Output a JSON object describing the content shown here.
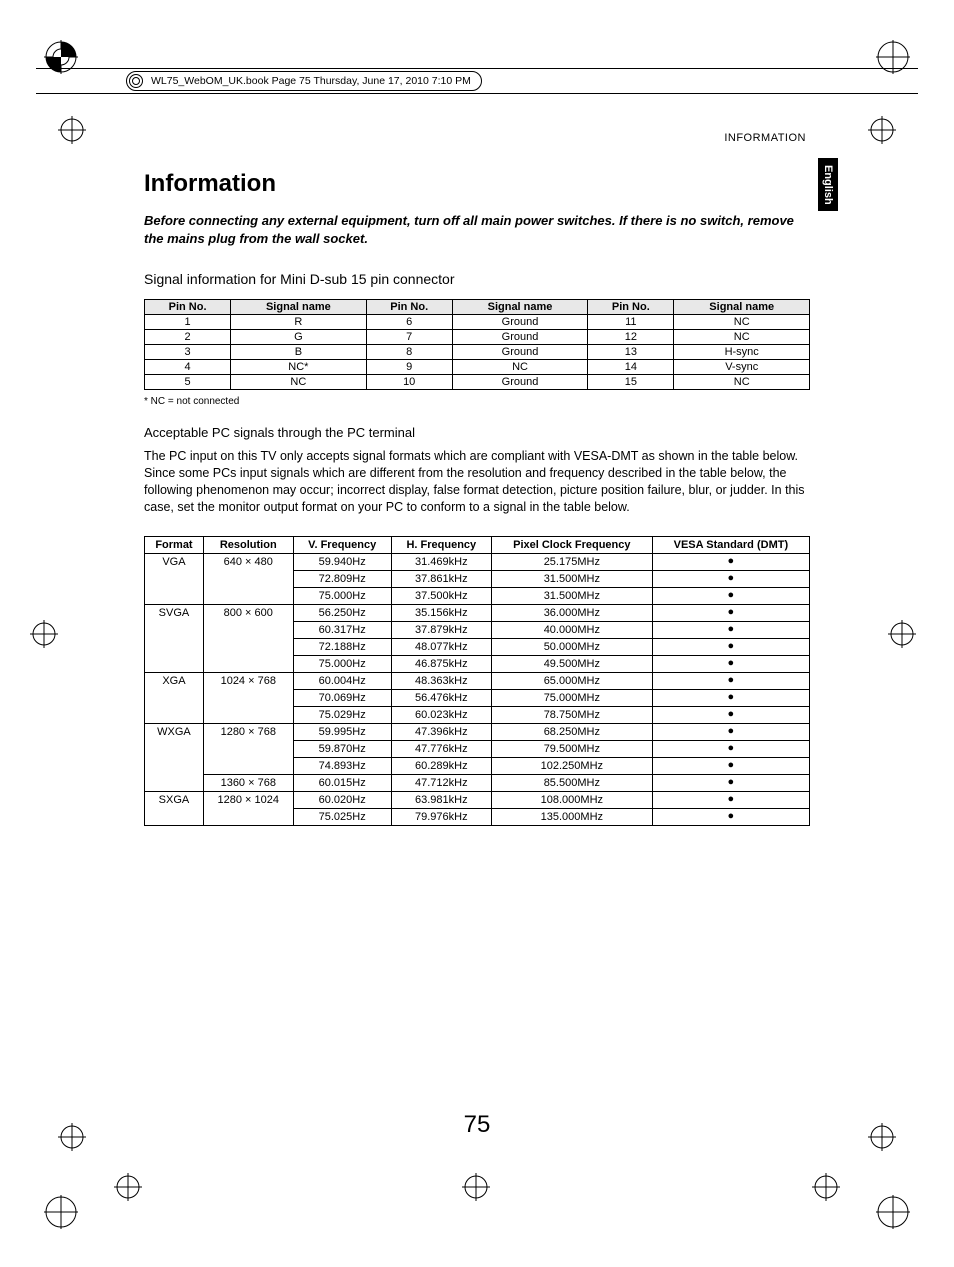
{
  "header_text": "WL75_WebOM_UK.book  Page 75  Thursday, June 17, 2010  7:10 PM",
  "running_head": "INFORMATION",
  "side_tab": "English",
  "title": "Information",
  "intro": "Before connecting any external equipment, turn off all main power switches. If there is no switch, remove the mains plug from the wall socket.",
  "pin_heading": "Signal information for Mini D-sub 15 pin connector",
  "pin_table": {
    "headers": [
      "Pin No.",
      "Signal name",
      "Pin No.",
      "Signal name",
      "Pin No.",
      "Signal name"
    ],
    "rows": [
      [
        "1",
        "R",
        "6",
        "Ground",
        "11",
        "NC"
      ],
      [
        "2",
        "G",
        "7",
        "Ground",
        "12",
        "NC"
      ],
      [
        "3",
        "B",
        "8",
        "Ground",
        "13",
        "H-sync"
      ],
      [
        "4",
        "NC*",
        "9",
        "NC",
        "14",
        "V-sync"
      ],
      [
        "5",
        "NC",
        "10",
        "Ground",
        "15",
        "NC"
      ]
    ]
  },
  "pin_footnote": "* NC = not connected",
  "pc_heading": "Acceptable PC signals through the PC terminal",
  "pc_body": "The PC input on this TV only accepts signal formats which are compliant with VESA-DMT as shown in the table below. Since some PCs input signals which are different from the resolution and frequency described in the table below, the following phenomenon may occur; incorrect display, false format detection, picture position failure, blur, or judder. In this case, set the monitor output format on your PC to conform to a signal in the table below.",
  "pc_table": {
    "headers": [
      "Format",
      "Resolution",
      "V. Frequency",
      "H. Frequency",
      "Pixel Clock Frequency",
      "VESA Standard (DMT)"
    ],
    "groups": [
      {
        "format": "VGA",
        "resolution": "640 × 480",
        "rows": [
          {
            "v": "59.940Hz",
            "h": "31.469kHz",
            "p": "25.175MHz",
            "dmt": true
          },
          {
            "v": "72.809Hz",
            "h": "37.861kHz",
            "p": "31.500MHz",
            "dmt": true
          },
          {
            "v": "75.000Hz",
            "h": "37.500kHz",
            "p": "31.500MHz",
            "dmt": true
          }
        ]
      },
      {
        "format": "SVGA",
        "resolution": "800 × 600",
        "rows": [
          {
            "v": "56.250Hz",
            "h": "35.156kHz",
            "p": "36.000MHz",
            "dmt": true
          },
          {
            "v": "60.317Hz",
            "h": "37.879kHz",
            "p": "40.000MHz",
            "dmt": true
          },
          {
            "v": "72.188Hz",
            "h": "48.077kHz",
            "p": "50.000MHz",
            "dmt": true
          },
          {
            "v": "75.000Hz",
            "h": "46.875kHz",
            "p": "49.500MHz",
            "dmt": true
          }
        ]
      },
      {
        "format": "XGA",
        "resolution": "1024 × 768",
        "rows": [
          {
            "v": "60.004Hz",
            "h": "48.363kHz",
            "p": "65.000MHz",
            "dmt": true
          },
          {
            "v": "70.069Hz",
            "h": "56.476kHz",
            "p": "75.000MHz",
            "dmt": true
          },
          {
            "v": "75.029Hz",
            "h": "60.023kHz",
            "p": "78.750MHz",
            "dmt": true
          }
        ]
      },
      {
        "format": "WXGA",
        "resolution": "1280 × 768",
        "rows": [
          {
            "v": "59.995Hz",
            "h": "47.396kHz",
            "p": "68.250MHz",
            "dmt": true
          },
          {
            "v": "59.870Hz",
            "h": "47.776kHz",
            "p": "79.500MHz",
            "dmt": true
          },
          {
            "v": "74.893Hz",
            "h": "60.289kHz",
            "p": "102.250MHz",
            "dmt": true
          }
        ]
      },
      {
        "format": "",
        "resolution": "1360 × 768",
        "rows": [
          {
            "v": "60.015Hz",
            "h": "47.712kHz",
            "p": "85.500MHz",
            "dmt": true
          }
        ]
      },
      {
        "format": "SXGA",
        "resolution": "1280 × 1024",
        "rows": [
          {
            "v": "60.020Hz",
            "h": "63.981kHz",
            "p": "108.000MHz",
            "dmt": true
          },
          {
            "v": "75.025Hz",
            "h": "79.976kHz",
            "p": "135.000MHz",
            "dmt": true
          }
        ]
      }
    ]
  },
  "page_number": "75"
}
